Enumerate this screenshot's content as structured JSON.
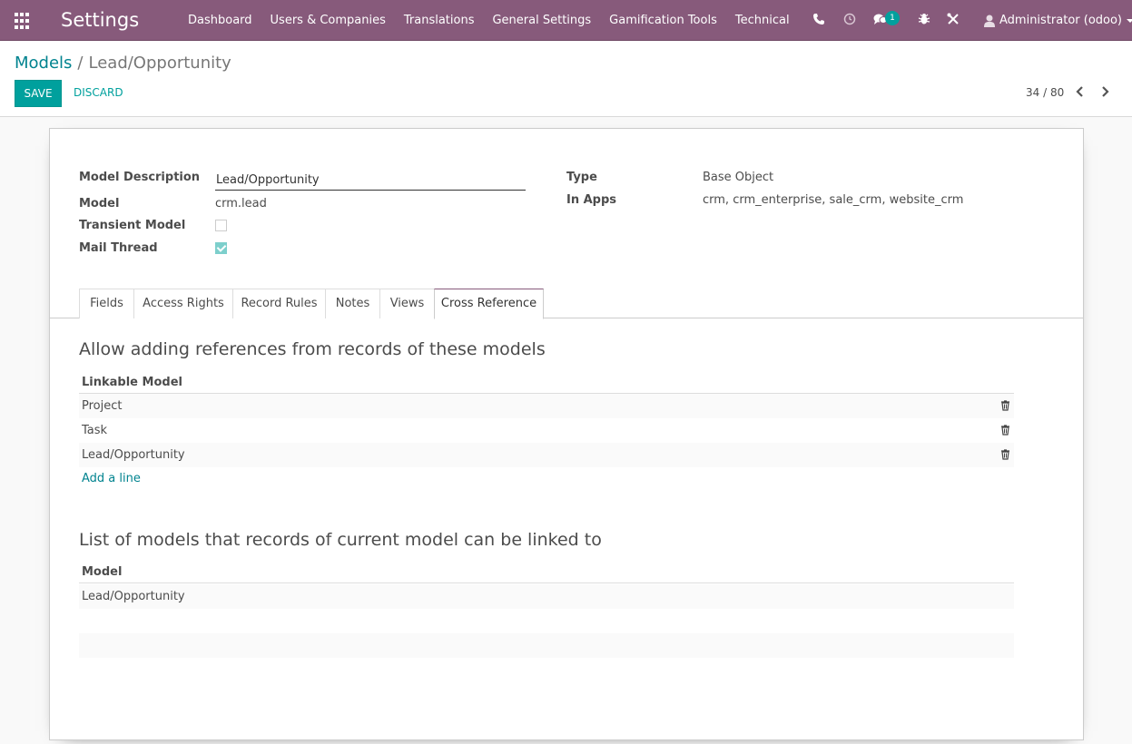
{
  "navbar": {
    "app_title": "Settings",
    "menu": [
      "Dashboard",
      "Users & Companies",
      "Translations",
      "General Settings",
      "Gamification Tools",
      "Technical"
    ],
    "chat_badge": "1",
    "user_name": "Administrator (odoo)"
  },
  "breadcrumb": {
    "parent": "Models",
    "separator": "/",
    "current": "Lead/Opportunity"
  },
  "actions": {
    "save_label": "SAVE",
    "discard_label": "DISCARD"
  },
  "pager": {
    "value": "34 / 80"
  },
  "form": {
    "model_description_label": "Model Description",
    "model_description_value": "Lead/Opportunity",
    "model_label": "Model",
    "model_value": "crm.lead",
    "transient_label": "Transient Model",
    "transient_checked": false,
    "mail_thread_label": "Mail Thread",
    "mail_thread_checked": true,
    "type_label": "Type",
    "type_value": "Base Object",
    "in_apps_label": "In Apps",
    "in_apps_value": "crm, crm_enterprise, sale_crm, website_crm"
  },
  "tabs": [
    "Fields",
    "Access Rights",
    "Record Rules",
    "Notes",
    "Views",
    "Cross Reference"
  ],
  "active_tab": "Cross Reference",
  "cross_reference": {
    "section1_title": "Allow adding references from records of these models",
    "section1_column": "Linkable Model",
    "section1_rows": [
      "Project",
      "Task",
      "Lead/Opportunity"
    ],
    "add_line": "Add a line",
    "section2_title": "List of models that records of current model can be linked to",
    "section2_column": "Model",
    "section2_rows": [
      "Lead/Opportunity"
    ]
  },
  "colors": {
    "navbar": "#875a7b",
    "primary": "#00a09d",
    "link": "#00838f"
  }
}
